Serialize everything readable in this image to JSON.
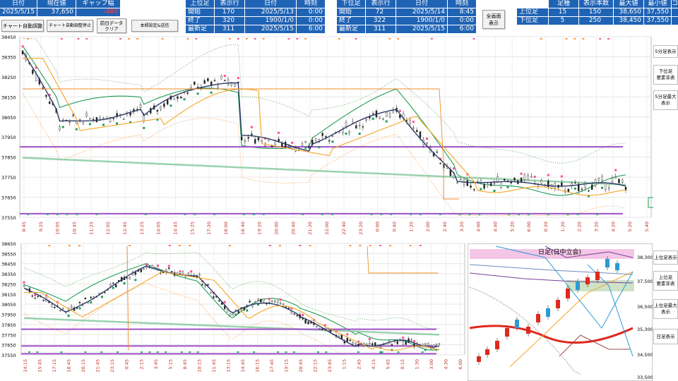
{
  "summary": {
    "date_header": "日付",
    "price_header": "現在値",
    "gap_header": "ギャップ幅",
    "date": "2025/5/15",
    "price": "37,650",
    "gap": "-480"
  },
  "buttons": {
    "chart_auto_adjust": "チャート自動調整",
    "chart_auto_adjust_stop": "チャート自動調整停止",
    "clear_prev_day": "前日データ\nクリア",
    "mail_send": "本緑設定&送信"
  },
  "upper_block": {
    "headers": [
      "上位足",
      "表示行",
      "日付",
      "時刻"
    ],
    "rows": [
      {
        "label": "開始",
        "rows": "170",
        "date": "2025/5/13",
        "time": "0:00"
      },
      {
        "label": "終了",
        "rows": "320",
        "date": "1900/1/0",
        "time": "0:00"
      },
      {
        "label": "最新足",
        "rows": "311",
        "date": "2025/5/15",
        "time": "6:00"
      }
    ]
  },
  "lower_block": {
    "headers": [
      "下位足",
      "表示行",
      "日付",
      "時刻"
    ],
    "rows": [
      {
        "label": "開始",
        "rows": "72",
        "date": "2025/5/14",
        "time": "8:45"
      },
      {
        "label": "終了",
        "rows": "322",
        "date": "1900/1/0",
        "time": "0:00"
      },
      {
        "label": "最新足",
        "rows": "311",
        "date": "2025/5/15",
        "time": "6:00"
      }
    ]
  },
  "fullscreen_button": "全画面\n表示",
  "range_table": {
    "headers": [
      "",
      "足種",
      "表示本数",
      "最大値",
      "最小値",
      "コ"
    ],
    "rows": [
      {
        "name": "上位足",
        "type": "15",
        "count": "150",
        "max": "38,650",
        "min": "37,550"
      },
      {
        "name": "下位足",
        "type": "5",
        "count": "250",
        "max": "38,450",
        "min": "37,550"
      }
    ]
  },
  "side_buttons": [
    "5分足表示",
    "下位足\n要素非表",
    "5分足最大\n表示",
    "上位足表示",
    "上位足\n要素非表",
    "上位足最大\n表示",
    "日足表示"
  ],
  "chart_top": {
    "y_ticks": [
      "38450",
      "38350",
      "38250",
      "38150",
      "38050",
      "37950",
      "37850",
      "37750",
      "37650",
      "37550"
    ],
    "x_ticks": [
      "8:45",
      "9:25",
      "10:05",
      "10:45",
      "11:25",
      "12:05",
      "12:45",
      "13:25",
      "14:05",
      "14:45",
      "15:25",
      "17:20",
      "18:00",
      "18:40",
      "19:20",
      "20:00",
      "20:40",
      "21:20",
      "22:00",
      "22:40",
      "23:20",
      "0:00",
      "0:40",
      "1:20",
      "2:00",
      "2:40",
      "3:20",
      "4:00",
      "4:40",
      "5:20",
      "6:00",
      "0:20",
      "1:20",
      "2:20",
      "3:20",
      "4:20",
      "5:20",
      "5:40"
    ]
  },
  "chart_bottom": {
    "y_ticks": [
      "38650",
      "38550",
      "38450",
      "38350",
      "38250",
      "38150",
      "38050",
      "37950",
      "37850",
      "37750",
      "37650",
      "37550"
    ],
    "x_ticks": [
      "14:15",
      "15:45",
      "17:15",
      "18:45",
      "20:15",
      "21:45",
      "23:15",
      "0:45",
      "2:15",
      "3:45",
      "5:15",
      "8:45",
      "10:15",
      "11:45",
      "13:15",
      "14:45",
      "16:15",
      "17:45",
      "19:15",
      "20:45",
      "22:15",
      "23:45",
      "1:15",
      "2:45",
      "4:15",
      "5:45",
      "0:15",
      "1:30",
      "3:00",
      "4:30",
      "6:00"
    ]
  },
  "daily_chart": {
    "title": "日足(日中立会)",
    "y_ticks": [
      "38,300",
      "37,500",
      "36,500",
      "35,300",
      "34,500",
      "33,500"
    ]
  },
  "colors": {
    "header_blue": "#1f63b5",
    "ma_dark": "#2e3a66",
    "ma_orange": "#f5a623",
    "ma_green": "#1f9d55",
    "band_purple": "#a050c8",
    "bollinger_dotted": "#4c9a4c",
    "resistance_orange": "#f08a24",
    "pink": "#ff5aa0"
  }
}
